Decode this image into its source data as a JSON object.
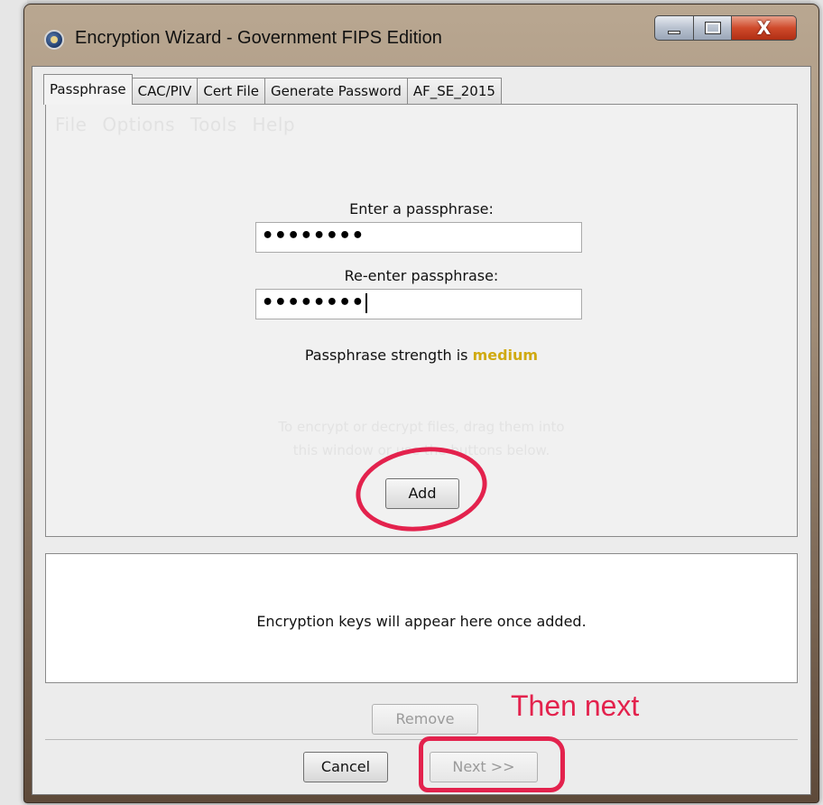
{
  "window": {
    "title": "Encryption Wizard - Government FIPS Edition",
    "controls": {
      "minimize": "",
      "maximize": "",
      "close": "X"
    }
  },
  "tabs": [
    {
      "label": "Passphrase",
      "active": true
    },
    {
      "label": "CAC/PIV"
    },
    {
      "label": "Cert File"
    },
    {
      "label": "Generate Password"
    },
    {
      "label": "AF_SE_2015"
    }
  ],
  "ghost_menu": [
    "File",
    "Options",
    "Tools",
    "Help"
  ],
  "passphrase": {
    "enter_label": "Enter a passphrase:",
    "enter_value": "••••••••",
    "reenter_label": "Re-enter passphrase:",
    "reenter_value": "••••••••",
    "strength_prefix": "Passphrase strength is ",
    "strength_level": "medium"
  },
  "ghost_hint": {
    "line1": "To encrypt or decrypt files, drag them into",
    "line2": "this window or use the buttons below."
  },
  "buttons": {
    "add": "Add",
    "remove": "Remove",
    "cancel": "Cancel",
    "next": "Next >>"
  },
  "keys_panel": {
    "placeholder": "Encryption keys will appear here once added."
  },
  "annotation": {
    "then_next": "Then next"
  },
  "colors": {
    "annotation": "#e3224d",
    "strength_medium": "#d0aa12"
  }
}
